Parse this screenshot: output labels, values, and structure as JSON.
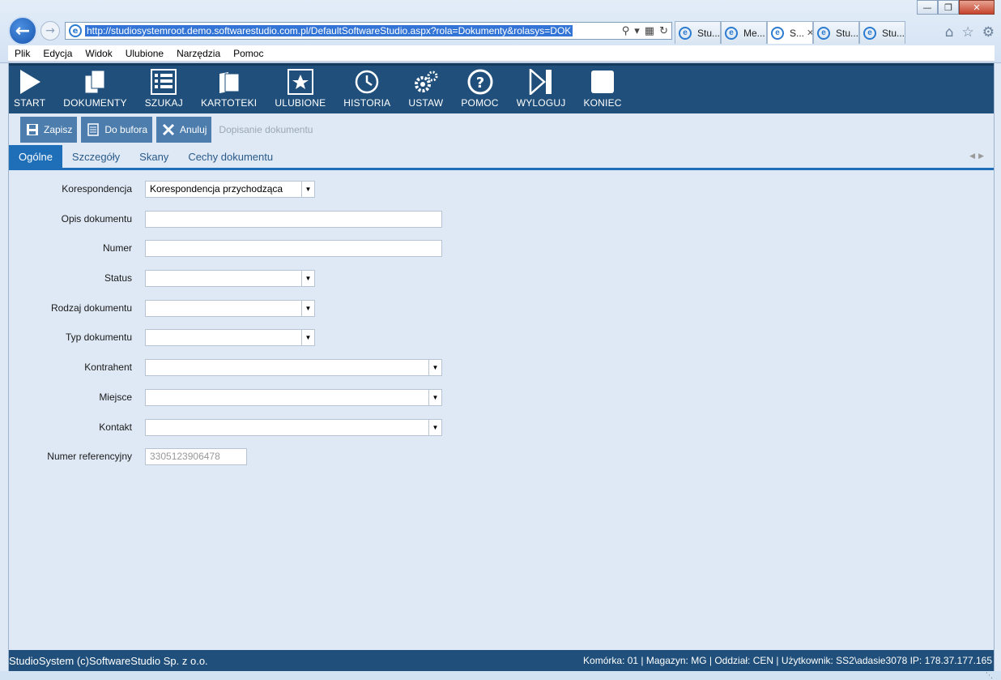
{
  "browser": {
    "url": "http://studiosystemroot.demo.softwarestudio.com.pl/DefaultSoftwareStudio.aspx?rola=Dokumenty&rolasys=DOK",
    "tabs": [
      {
        "label": "Stu..."
      },
      {
        "label": "Me..."
      },
      {
        "label": "S..."
      },
      {
        "label": "Stu..."
      },
      {
        "label": "Stu..."
      }
    ],
    "menu": [
      "Plik",
      "Edycja",
      "Widok",
      "Ulubione",
      "Narzędzia",
      "Pomoc"
    ]
  },
  "toolbar": {
    "items": [
      {
        "label": "START",
        "icon": "play-icon"
      },
      {
        "label": "DOKUMENTY",
        "icon": "documents-icon"
      },
      {
        "label": "SZUKAJ",
        "icon": "search-grid-icon"
      },
      {
        "label": "KARTOTEKI",
        "icon": "folder-icon"
      },
      {
        "label": "ULUBIONE",
        "icon": "star-icon"
      },
      {
        "label": "HISTORIA",
        "icon": "history-icon"
      },
      {
        "label": "USTAW",
        "icon": "gear-icon"
      },
      {
        "label": "POMOC",
        "icon": "help-icon"
      },
      {
        "label": "WYLOGUJ",
        "icon": "logout-icon"
      },
      {
        "label": "KONIEC",
        "icon": "stop-icon"
      }
    ]
  },
  "actions": {
    "save": "Zapisz",
    "buffer": "Do bufora",
    "cancel": "Anuluj",
    "caption": "Dopisanie dokumentu"
  },
  "form_tabs": [
    "Ogólne",
    "Szczegóły",
    "Skany",
    "Cechy dokumentu"
  ],
  "form": {
    "korespondencja": {
      "label": "Korespondencja",
      "value": "Korespondencja przychodząca"
    },
    "opis": {
      "label": "Opis dokumentu",
      "value": ""
    },
    "numer": {
      "label": "Numer",
      "value": ""
    },
    "status": {
      "label": "Status",
      "value": ""
    },
    "rodzaj": {
      "label": "Rodzaj dokumentu",
      "value": ""
    },
    "typ": {
      "label": "Typ dokumentu",
      "value": ""
    },
    "kontrahent": {
      "label": "Kontrahent",
      "value": ""
    },
    "miejsce": {
      "label": "Miejsce",
      "value": ""
    },
    "kontakt": {
      "label": "Kontakt",
      "value": ""
    },
    "numer_ref": {
      "label": "Numer referencyjny",
      "value": "3305123906478"
    }
  },
  "status": {
    "left": "StudioSystem (c)SoftwareStudio Sp. z o.o.",
    "right": "Komórka: 01 | Magazyn: MG | Oddział: CEN | Użytkownik: SS2\\adasie3078 IP: 178.37.177.165"
  },
  "colors": {
    "toolbar_bg": "#1f4f7a",
    "active_tab": "#1e6fb8",
    "action_btn": "#4c7dad"
  }
}
